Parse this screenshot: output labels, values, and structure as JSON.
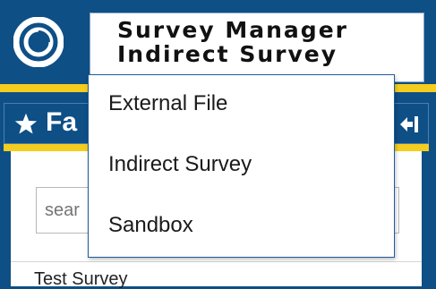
{
  "header": {
    "title_line1": "Survey Manager",
    "title_line2": "Indirect Survey",
    "logo_icon": "swirl-logo-icon"
  },
  "favorites": {
    "title": "Fa",
    "search_placeholder": "sear",
    "items": [
      {
        "label": "Test Survey"
      }
    ],
    "star_icon": "star-icon",
    "collapse_icon": "collapse-left-icon"
  },
  "dropdown": {
    "items": [
      {
        "label": "External File"
      },
      {
        "label": "Indirect Survey"
      },
      {
        "label": "Sandbox"
      }
    ]
  },
  "colors": {
    "brand_blue": "#0e4f86",
    "accent_yellow": "#f5cd1e",
    "white": "#ffffff"
  }
}
